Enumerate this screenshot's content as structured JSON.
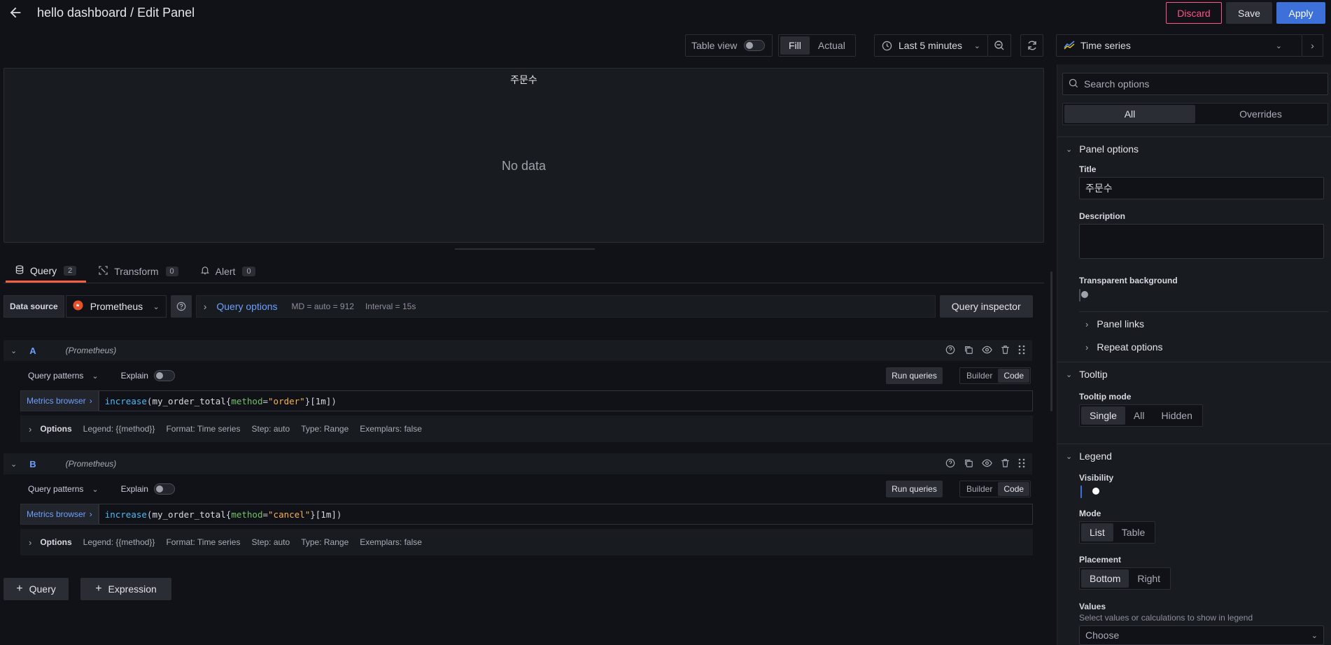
{
  "header": {
    "title": "hello dashboard / Edit Panel",
    "discard_label": "Discard",
    "save_label": "Save",
    "apply_label": "Apply"
  },
  "toolbar": {
    "table_view_label": "Table view",
    "fill_label": "Fill",
    "actual_label": "Actual",
    "time_range": "Last 5 minutes",
    "visualization": "Time series"
  },
  "panel": {
    "title": "주문수",
    "empty_text": "No data"
  },
  "tabs": [
    {
      "label": "Query",
      "count": "2"
    },
    {
      "label": "Transform",
      "count": "0"
    },
    {
      "label": "Alert",
      "count": "0"
    }
  ],
  "datasource": {
    "label": "Data source",
    "name": "Prometheus",
    "query_options_label": "Query options",
    "md": "MD = auto = 912",
    "interval": "Interval = 15s",
    "inspector_label": "Query inspector"
  },
  "queries": [
    {
      "ref": "A",
      "ds": "(Prometheus)",
      "patterns_label": "Query patterns",
      "explain_label": "Explain",
      "run_label": "Run queries",
      "builder_label": "Builder",
      "code_label": "Code",
      "metrics_label": "Metrics browser",
      "expr_fn": "increase",
      "expr_metric": "my_order_total",
      "expr_key": "method",
      "expr_value": "\"order\"",
      "expr_range": "[1m]",
      "options_label": "Options",
      "legend": "Legend: {{method}}",
      "format": "Format: Time series",
      "step": "Step: auto",
      "type": "Type: Range",
      "exemplars": "Exemplars: false"
    },
    {
      "ref": "B",
      "ds": "(Prometheus)",
      "patterns_label": "Query patterns",
      "explain_label": "Explain",
      "run_label": "Run queries",
      "builder_label": "Builder",
      "code_label": "Code",
      "metrics_label": "Metrics browser",
      "expr_fn": "increase",
      "expr_metric": "my_order_total",
      "expr_key": "method",
      "expr_value": "\"cancel\"",
      "expr_range": "[1m]",
      "options_label": "Options",
      "legend": "Legend: {{method}}",
      "format": "Format: Time series",
      "step": "Step: auto",
      "type": "Type: Range",
      "exemplars": "Exemplars: false"
    }
  ],
  "add": {
    "query_label": "Query",
    "expression_label": "Expression"
  },
  "options_pane": {
    "search_placeholder": "Search options",
    "all_label": "All",
    "overrides_label": "Overrides",
    "panel_options_label": "Panel options",
    "title_label": "Title",
    "title_value": "주문수",
    "description_label": "Description",
    "transparent_label": "Transparent background",
    "panel_links_label": "Panel links",
    "repeat_label": "Repeat options",
    "tooltip_label": "Tooltip",
    "tooltip_mode_label": "Tooltip mode",
    "tooltip_modes": [
      "Single",
      "All",
      "Hidden"
    ],
    "legend_label": "Legend",
    "visibility_label": "Visibility",
    "mode_label": "Mode",
    "modes": [
      "List",
      "Table"
    ],
    "placement_label": "Placement",
    "placements": [
      "Bottom",
      "Right"
    ],
    "values_label": "Values",
    "values_desc": "Select values or calculations to show in legend",
    "values_placeholder": "Choose"
  },
  "colors": {
    "apply": "#3d71d9",
    "discard": "#ff5286",
    "tab_underline": "#f55f3e",
    "link": "#6e9fff"
  }
}
